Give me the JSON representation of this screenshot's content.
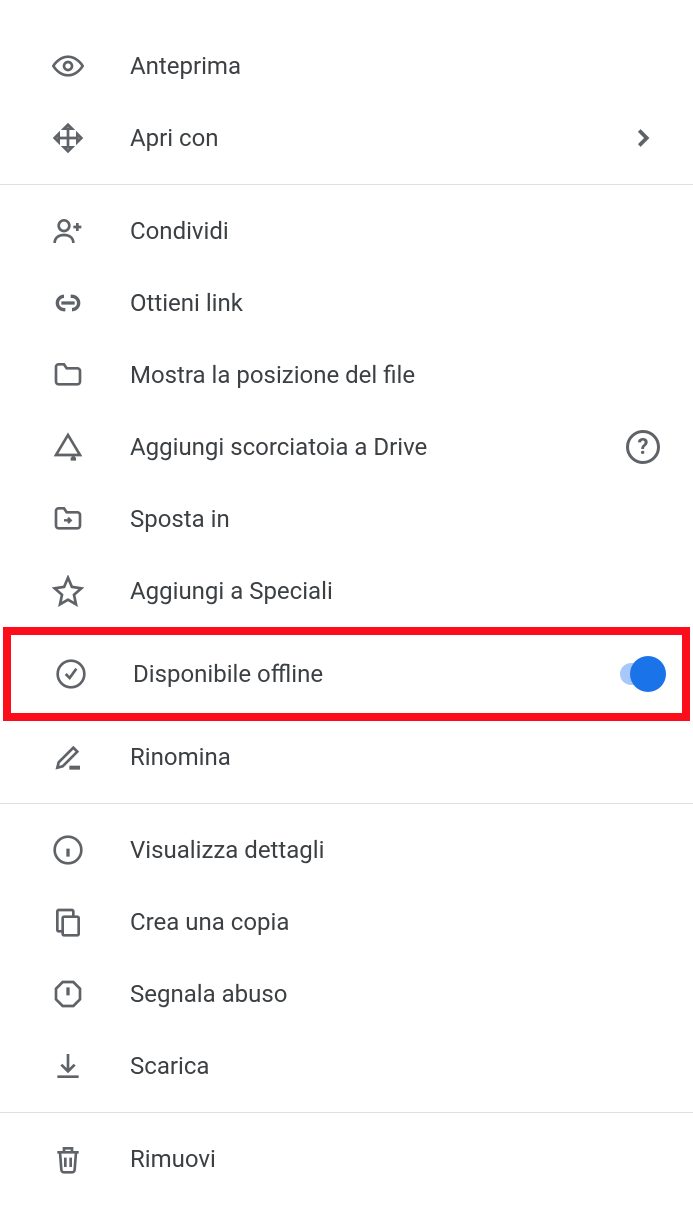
{
  "menu": {
    "group1": {
      "preview": "Anteprima",
      "open_with": "Apri con"
    },
    "group2": {
      "share": "Condividi",
      "get_link": "Ottieni link",
      "show_location": "Mostra la posizione del file",
      "add_shortcut": "Aggiungi scorciatoia a Drive",
      "move_to": "Sposta in",
      "add_star": "Aggiungi a Speciali",
      "available_offline": "Disponibile offline",
      "rename": "Rinomina"
    },
    "group3": {
      "view_details": "Visualizza dettagli",
      "make_copy": "Crea una copia",
      "report_abuse": "Segnala abuso",
      "download": "Scarica"
    },
    "group4": {
      "remove": "Rimuovi"
    },
    "offline_toggle_on": true
  }
}
